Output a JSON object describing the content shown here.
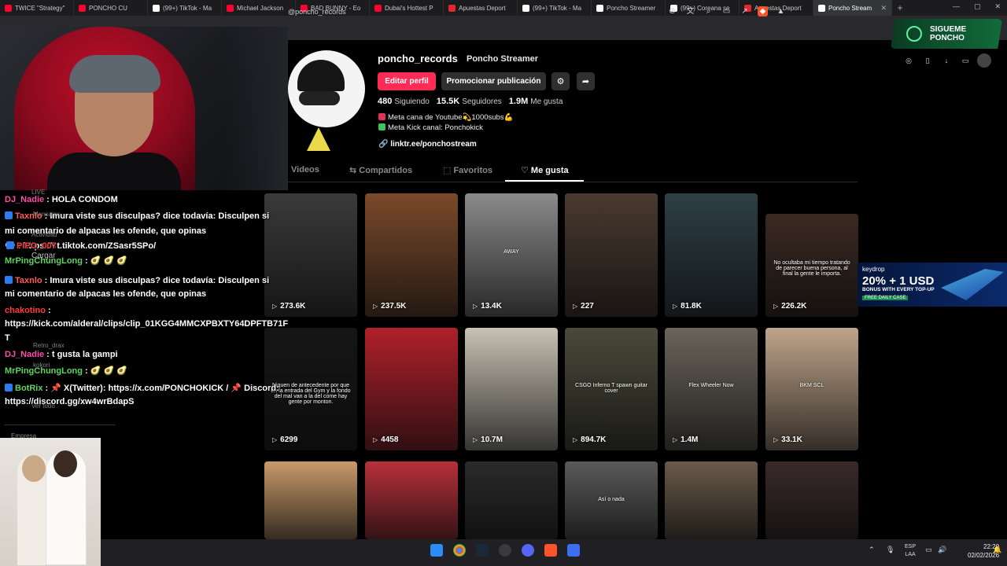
{
  "browser": {
    "tabs": [
      {
        "label": "TWICE \"Strategy\"",
        "color": "#ff0033"
      },
      {
        "label": "PONCHO CU",
        "color": "#ff0033"
      },
      {
        "label": "(99+) TikTok - Ma",
        "color": "#ffffff"
      },
      {
        "label": "Michael Jackson",
        "color": "#ff0033"
      },
      {
        "label": "BAD BUNNY - Eo",
        "color": "#ff0033"
      },
      {
        "label": "Dubai's Hottest P",
        "color": "#ff0033"
      },
      {
        "label": "Apuestas Deport",
        "color": "#e3262f"
      },
      {
        "label": "(99+) TikTok - Ma",
        "color": "#ffffff"
      },
      {
        "label": "Poncho Streamer",
        "color": "#ffffff"
      },
      {
        "label": "(99+) Coreana se",
        "color": "#ffffff"
      },
      {
        "label": "Apuestas Deport",
        "color": "#e3262f"
      }
    ],
    "active_tab": "Poncho Stream",
    "url": "@poncho_records"
  },
  "chat": {
    "lines": [
      {
        "user": "DJ_Nadie",
        "user_color": "#ff4fa8",
        "text": ": HOLA CONDOM"
      },
      {
        "user": "Taxnlo",
        "user_color": "#ff5a5a",
        "text": ": Imura viste sus disculpas? dice todavía: Disculpen si"
      },
      {
        "user": "",
        "user_color": "#ffffff",
        "text": "mi comentario de alpacas les ofende, que opinas"
      },
      {
        "user": "",
        "user_color": "#ffffff",
        "text": "💬 : https://vt.tiktok.com/ZSasr5SPo/"
      },
      {
        "user": "PIPO_007",
        "user_color": "#ff3b3b",
        "text": ""
      },
      {
        "user": "MrPingChungLong",
        "user_color": "#5cd65c",
        "text": ": 🥑 🥑 🥑"
      },
      {
        "user": "Taxnlo",
        "user_color": "#ff5a5a",
        "text": ": Imura viste sus disculpas? dice todavía: Disculpen si"
      },
      {
        "user": "",
        "user_color": "#ffffff",
        "text": "mi comentario de alpacas les ofende, que opinas"
      },
      {
        "user": "chakotino",
        "user_color": "#ff3b3b",
        "text": ":"
      },
      {
        "user": "",
        "user_color": "#ffffff",
        "text": "https://kick.com/alderal/clips/clip_01KGG4MMCXPBXTY64DPFTB71F"
      },
      {
        "user": "",
        "user_color": "#ffffff",
        "text": "T"
      },
      {
        "user": "DJ_Nadie",
        "user_color": "#ff4fa8",
        "text": ": t gusta la gampi"
      },
      {
        "user": "MrPingChungLong",
        "user_color": "#5cd65c",
        "text": ": 🥑 🥑 🥑"
      },
      {
        "user": "BotRix",
        "user_color": "#5cd65c",
        "text": ": 📌 X(Twitter): https://x.com/PONCHOKICK / 📌 Discord:"
      },
      {
        "user": "",
        "user_color": "#ffffff",
        "text": "https://discord.gg/xw4wrBdapS"
      }
    ],
    "faint_items": [
      "LIVE",
      "Mensajes",
      "Actividad",
      "Cargar",
      "Retro_drax",
      "kokori",
      "Ver todo"
    ],
    "section_label": "Empresa"
  },
  "profile": {
    "username": "poncho_records",
    "display_name": "Poncho Streamer",
    "edit_button": "Editar perfil",
    "promote_button": "Promocionar publicación",
    "settings_icon": "gear-icon",
    "share_icon": "share-icon",
    "following_count": "480",
    "following_label": "Siguiendo",
    "followers_count": "15.5K",
    "followers_label": "Seguidores",
    "likes_count": "1.9M",
    "likes_label": "Me gusta",
    "bio_line1": "Meta cana de Youtube💫1000subs💪",
    "bio_line2": "Meta Kick canal: Ponchokick",
    "link": "linktr.ee/ponchostream"
  },
  "profile_tabs": [
    {
      "label": "Videos",
      "active": false
    },
    {
      "label": "Compartidos",
      "active": false
    },
    {
      "label": "Favoritos",
      "active": false
    },
    {
      "label": "Me gusta",
      "active": true
    }
  ],
  "videos": [
    {
      "views": "273.6K",
      "caption": "",
      "color": "#3a3a3a"
    },
    {
      "views": "237.5K",
      "caption": "",
      "color": "#7a4a2a"
    },
    {
      "views": "13.4K",
      "caption": "AWAY",
      "color": "#8a8a8a"
    },
    {
      "views": "227",
      "caption": "",
      "color": "#4a3a30"
    },
    {
      "views": "81.8K",
      "caption": "",
      "color": "#2e3f46"
    },
    {
      "views": "226.2K",
      "caption": "No ocultaba mi tiempo tratando de parecer buena persona, al final la gente le importa.",
      "color": "#3a2a22"
    },
    {
      "views": "6299",
      "caption": "Niguen de antecedente por que en la entrada del Gym y la fondo del mal van a la del come hay gente por monton.",
      "color": "#161616"
    },
    {
      "views": "4458",
      "caption": "",
      "color": "#b0202a"
    },
    {
      "views": "10.7M",
      "caption": "",
      "color": "#c8c2b4"
    },
    {
      "views": "894.7K",
      "caption": "CSGO Inferno T spawn guitar cover",
      "color": "#4a4a3a"
    },
    {
      "views": "1.4M",
      "caption": "Flex Wheeler Now",
      "color": "#6a645a"
    },
    {
      "views": "33.1K",
      "caption": "BKM SCL",
      "color": "#bfa48a"
    },
    {
      "views": "",
      "caption": "",
      "color": "#c89a6a"
    },
    {
      "views": "",
      "caption": "",
      "color": "#b8303a"
    },
    {
      "views": "",
      "caption": "",
      "color": "#2a2a2a"
    },
    {
      "views": "",
      "caption": "Así o nada",
      "color": "#5a5a5a"
    },
    {
      "views": "",
      "caption": "",
      "color": "#6a5a4a"
    },
    {
      "views": "",
      "caption": "",
      "color": "#3a2a2a"
    }
  ],
  "overlays": {
    "follow_banner": "SIGUEME PONCHO",
    "keydrop_brand": "keydrop",
    "keydrop_offer": "20% + 1 USD",
    "keydrop_sub": "BONUS WITH EVERY TOP-UP",
    "keydrop_case": "FREE DAILY CASE"
  },
  "taskbar": {
    "lang_top": "ESP",
    "lang_bottom": "LAA",
    "time": "22:20",
    "date": "02/02/2026"
  }
}
